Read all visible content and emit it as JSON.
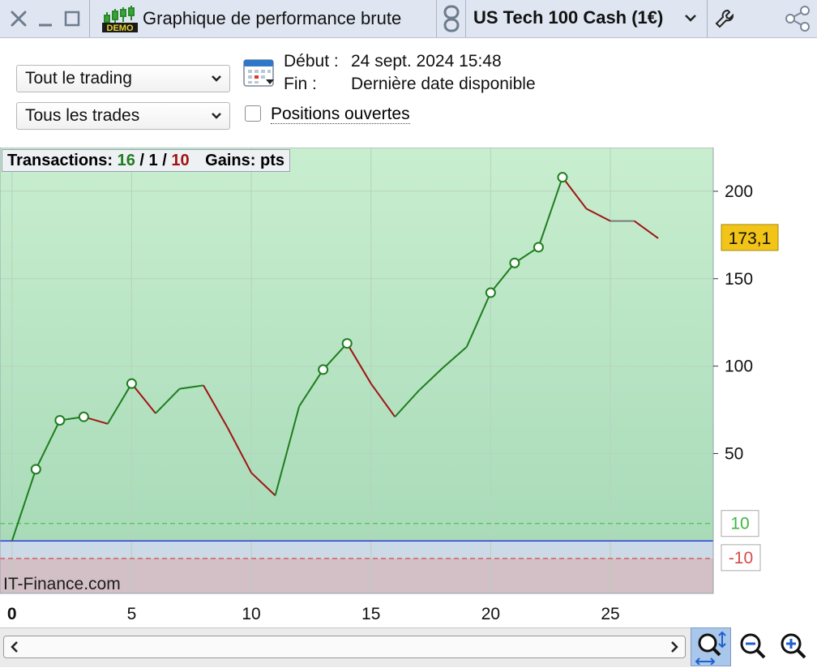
{
  "window": {
    "title": "Graphique de performance brute",
    "demo_badge": "DEMO",
    "instrument": "US Tech 100 Cash (1€)"
  },
  "filters": {
    "trading_select": "Tout le trading",
    "trades_select": "Tous les trades",
    "debut_label": "Début :",
    "debut_value": "24 sept. 2024 15:48",
    "fin_label": "Fin :",
    "fin_value": "Dernière date disponible",
    "open_positions_label": "Positions ouvertes",
    "open_positions_checked": false
  },
  "status": {
    "transactions_label": "Transactions:",
    "winners": "16",
    "neutral": "1",
    "losers": "10",
    "gains_label": "Gains:",
    "gains_unit": "pts"
  },
  "chart_data": {
    "type": "line",
    "x": [
      0,
      1,
      2,
      3,
      4,
      5,
      6,
      7,
      8,
      9,
      10,
      11,
      12,
      13,
      14,
      15,
      16,
      17,
      18,
      19,
      20,
      21,
      22,
      23,
      24,
      25,
      26,
      27
    ],
    "values": [
      0,
      41,
      69,
      71,
      67,
      90,
      73,
      87,
      89,
      65,
      39,
      26,
      77,
      98,
      113,
      90,
      71,
      86,
      99,
      111,
      142,
      159,
      168,
      208,
      190,
      183,
      183,
      173.1
    ],
    "step_result": [
      "",
      "gain",
      "gain",
      "gain",
      "loss",
      "gain",
      "loss",
      "gain",
      "gain",
      "loss",
      "loss",
      "loss",
      "gain",
      "gain",
      "gain",
      "loss",
      "loss",
      "gain",
      "gain",
      "gain",
      "gain",
      "gain",
      "gain",
      "gain",
      "loss",
      "loss",
      "flat",
      "loss"
    ],
    "markers_at": [
      1,
      2,
      3,
      5,
      13,
      14,
      20,
      21,
      22,
      23
    ],
    "x_ticks": [
      "0",
      "5",
      "10",
      "15",
      "20",
      "25"
    ],
    "x_tick_values": [
      0,
      5,
      10,
      15,
      20,
      25
    ],
    "y_ticks": [
      "50",
      "100",
      "150",
      "200"
    ],
    "y_tick_values": [
      50,
      100,
      150,
      200
    ],
    "ylim": [
      -30,
      225
    ],
    "xlim": [
      -0.5,
      29.3
    ],
    "current_value_label": "173,1",
    "upper_threshold": 10,
    "upper_threshold_label": "10",
    "lower_threshold": -10,
    "lower_threshold_label": "-10",
    "watermark": "IT-Finance.com",
    "grid": true,
    "colors": {
      "gain": "#1e7d1e",
      "loss": "#a01414",
      "profit_zone": "#bfe8c8",
      "loss_zone": "#d3bfc6",
      "zero_line": "#2a3fd6",
      "label_highlight": "#f2c418"
    }
  }
}
